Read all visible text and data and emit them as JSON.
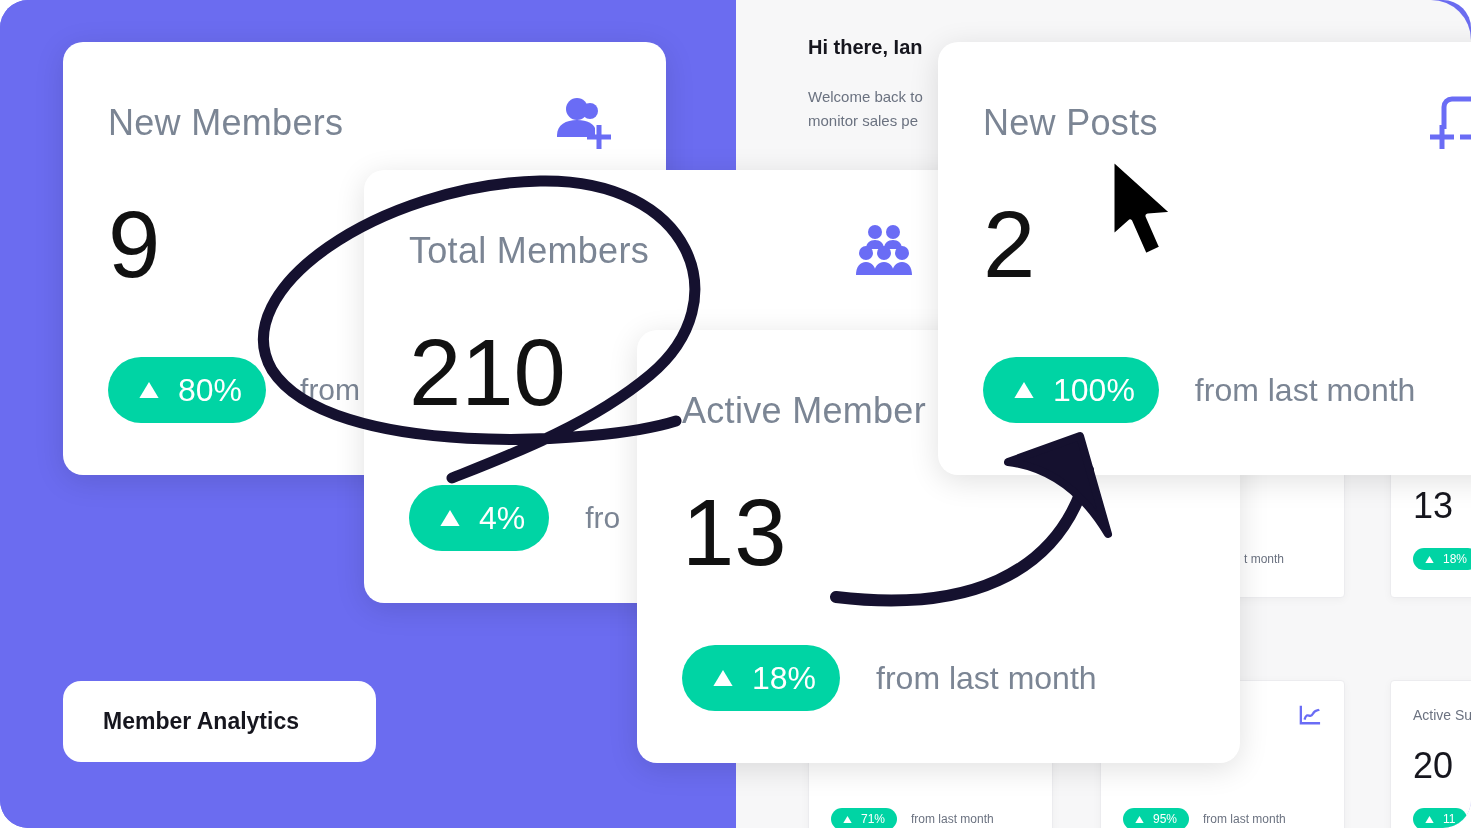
{
  "dashboard": {
    "greeting": "Hi there, Ian",
    "intro_lines": [
      "Welcome back to",
      "monitor sales pe"
    ],
    "cards": [
      {
        "footer": "t month"
      },
      {
        "value": "13",
        "change": "18%"
      },
      {
        "change": "71%",
        "footer": "from last month"
      },
      {
        "change": "95%",
        "footer": "from last month"
      },
      {
        "title": "Active Su",
        "value": "20",
        "change": "11"
      }
    ]
  },
  "stat_cards": [
    {
      "title": "New Members",
      "value": "9",
      "change": "80%",
      "footer": "from"
    },
    {
      "title": "Total Members",
      "value": "210",
      "change": "4%",
      "footer": "fro"
    },
    {
      "title": "Active Member",
      "value": "13",
      "change": "18%",
      "footer": "from last month"
    },
    {
      "title": "New Posts",
      "value": "2",
      "change": "100%",
      "footer": "from last month"
    }
  ],
  "analytics_button": {
    "label": "Member Analytics"
  }
}
